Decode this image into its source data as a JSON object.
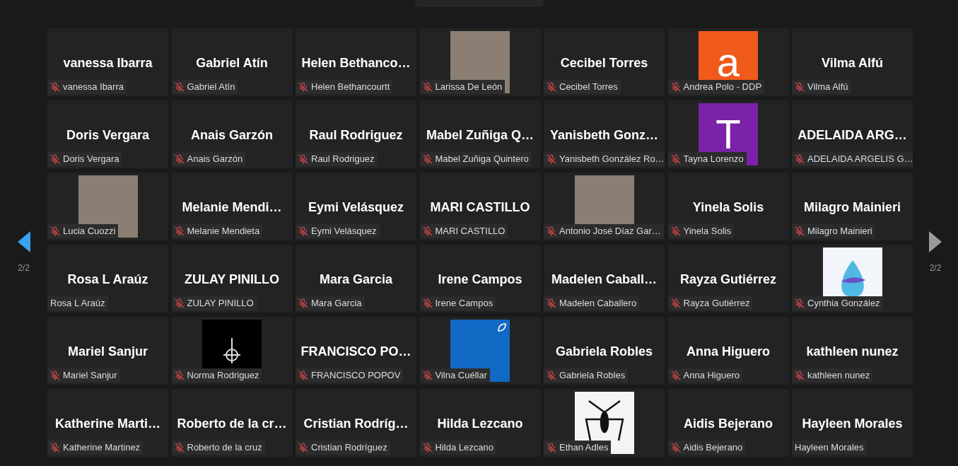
{
  "tiles": [
    {
      "kind": "name",
      "display": "vanessa Ibarra",
      "label": "vanessa Ibarra",
      "muted": true
    },
    {
      "kind": "name",
      "display": "Gabriel Atín",
      "label": "Gabriel Atín",
      "muted": true
    },
    {
      "kind": "name",
      "display": "Helen Bethanco…",
      "label": "Helen Bethancourtt",
      "muted": true
    },
    {
      "kind": "photo",
      "label": "Larissa De León",
      "muted": true
    },
    {
      "kind": "name",
      "display": "Cecibel Torres",
      "label": "Cecibel Torres",
      "muted": true
    },
    {
      "kind": "letter",
      "display": "a",
      "color": "#f05a1a",
      "label": "Andrea Polo - DDP",
      "muted": true
    },
    {
      "kind": "name",
      "display": "Vilma Alfú",
      "label": "Vilma Alfú",
      "muted": true
    },
    {
      "kind": "name",
      "display": "Doris Vergara",
      "label": "Doris Vergara",
      "muted": true
    },
    {
      "kind": "name",
      "display": "Anais Garzón",
      "label": "Anais Garzón",
      "muted": true
    },
    {
      "kind": "name",
      "display": "Raul Rodriguez",
      "label": "Raul Rodriguez",
      "muted": true
    },
    {
      "kind": "name",
      "display": "Mabel Zuñiga Q…",
      "label": "Mabel Zuñiga Quintero",
      "muted": true
    },
    {
      "kind": "name",
      "display": "Yanisbeth Gonz…",
      "label": "Yanisbeth González Ro…",
      "muted": true
    },
    {
      "kind": "letter",
      "display": "T",
      "color": "#7b22a8",
      "label": "Tayna Lorenzo",
      "muted": true
    },
    {
      "kind": "name",
      "display": "ADELAIDA ARG…",
      "label": "ADELAIDA ARGELIS G…",
      "muted": true
    },
    {
      "kind": "photo",
      "label": "Lucia Cuozzi",
      "muted": true
    },
    {
      "kind": "name",
      "display": "Melanie Mendi…",
      "label": "Melanie Mendieta",
      "muted": true
    },
    {
      "kind": "name",
      "display": "Eymi Velásquez",
      "label": "Eymi Velásquez",
      "muted": true
    },
    {
      "kind": "name",
      "display": "MARI CASTILLO",
      "label": "MARI CASTILLO",
      "muted": true
    },
    {
      "kind": "photo",
      "label": "Antonio José Díaz Gar…",
      "muted": true
    },
    {
      "kind": "name",
      "display": "Yinela Solis",
      "label": "Yinela Solis",
      "muted": true
    },
    {
      "kind": "name",
      "display": "Milagro Mainieri",
      "label": "Milagro Mainieri",
      "muted": true
    },
    {
      "kind": "name",
      "display": "Rosa L Araúz",
      "label": "Rosa L Araúz",
      "muted": false
    },
    {
      "kind": "name",
      "display": "ZULAY PINILLO",
      "label": "ZULAY PINILLO",
      "muted": true
    },
    {
      "kind": "name",
      "display": "Mara Garcia",
      "label": "Mara Garcia",
      "muted": true
    },
    {
      "kind": "name",
      "display": "Irene Campos",
      "label": "Irene Campos",
      "muted": true
    },
    {
      "kind": "name",
      "display": "Madelen Caball…",
      "label": "Madelen Caballero",
      "muted": true
    },
    {
      "kind": "name",
      "display": "Rayza Gutiérrez",
      "label": "Rayza Gutiérrez",
      "muted": true
    },
    {
      "kind": "artwork",
      "label": "Cynthia González",
      "muted": true
    },
    {
      "kind": "name",
      "display": "Mariel Sanjur",
      "label": "Mariel Sanjur",
      "muted": true
    },
    {
      "kind": "symbol",
      "label": "Norma Rodriguez",
      "muted": true
    },
    {
      "kind": "name",
      "display": "FRANCISCO PO…",
      "label": "FRANCISCO POPOV",
      "muted": true
    },
    {
      "kind": "tile",
      "label": "Vilna Cuéllar",
      "muted": true
    },
    {
      "kind": "name",
      "display": "Gabriela Robles",
      "label": "Gabriela Robles",
      "muted": true
    },
    {
      "kind": "name",
      "display": "Anna Higuero",
      "label": "Anna Higuero",
      "muted": true
    },
    {
      "kind": "name",
      "display": "kathleen nunez",
      "label": "kathleen nunez",
      "muted": true
    },
    {
      "kind": "name",
      "display": "Katherine Marti…",
      "label": "Katherine Martinez",
      "muted": true
    },
    {
      "kind": "name",
      "display": "Roberto de la cr…",
      "label": "Roberto de la cruz",
      "muted": true
    },
    {
      "kind": "name",
      "display": "Cristian Rodríg…",
      "label": "Cristian Rodríguez",
      "muted": true
    },
    {
      "kind": "name",
      "display": "Hilda Lezcano",
      "label": "Hilda Lezcano",
      "muted": true
    },
    {
      "kind": "spider",
      "label": "Ethan Adles",
      "muted": true
    },
    {
      "kind": "name",
      "display": "Aidis Bejerano",
      "label": "Aidis Bejerano",
      "muted": true
    },
    {
      "kind": "name",
      "display": "Hayleen Morales",
      "label": "Hayleen Morales",
      "muted": false
    }
  ],
  "pager": {
    "left": "2/2",
    "right": "2/2"
  }
}
